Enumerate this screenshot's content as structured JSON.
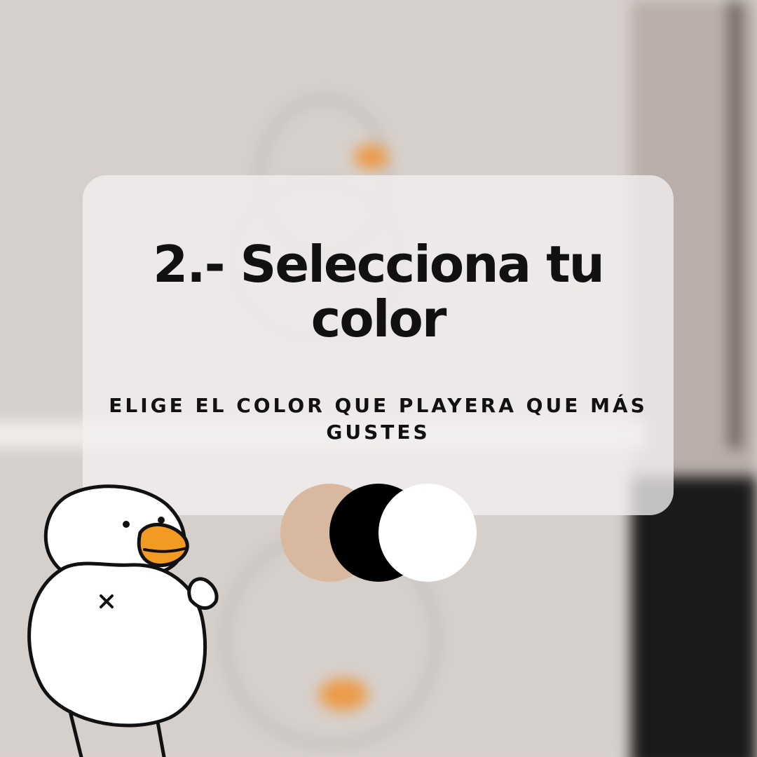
{
  "title": "2.- Selecciona tu color",
  "subtitle": "ELIGE EL COLOR QUE PLAYERA QUE MÁS GUSTES",
  "swatches": [
    {
      "name": "beige",
      "color": "#d8b9a0"
    },
    {
      "name": "black",
      "color": "#000000"
    },
    {
      "name": "white",
      "color": "#ffffff"
    }
  ],
  "colors": {
    "background": "#d9d3cf",
    "card": "#f2f0ef",
    "text": "#111111",
    "beak": "#f39a22"
  },
  "illustration": "duck-mascot"
}
